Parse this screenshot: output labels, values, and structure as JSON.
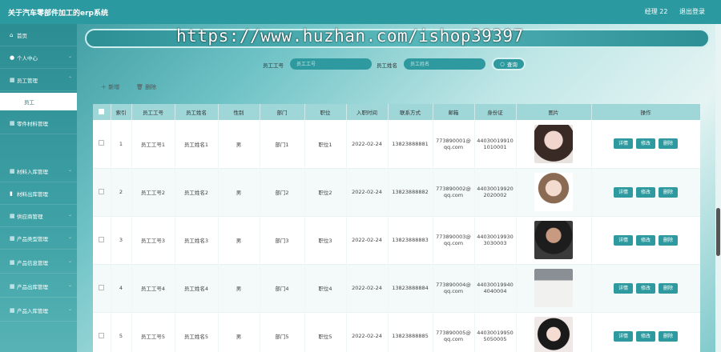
{
  "header": {
    "title": "关于汽车零部件加工的erp系统",
    "user": "经理 22",
    "logout": "退出登录"
  },
  "watermark_url": "https://www.huzhan.com/ishop39397",
  "sidebar": {
    "items": [
      {
        "label": "首页",
        "icon": "home-icon"
      },
      {
        "label": "个人中心",
        "icon": "user-icon"
      },
      {
        "label": "员工管理",
        "icon": "grid-icon"
      },
      {
        "label": "员工",
        "icon": ""
      },
      {
        "label": "零件材料管理",
        "icon": "grid-icon"
      },
      {
        "label": "材料入库管理",
        "icon": "grid-icon"
      },
      {
        "label": "材料出库管理",
        "icon": "chart-icon"
      },
      {
        "label": "供应商管理",
        "icon": "grid-icon"
      },
      {
        "label": "产品类型管理",
        "icon": "grid-icon"
      },
      {
        "label": "产品信息管理",
        "icon": "grid-icon"
      },
      {
        "label": "产品出库管理",
        "icon": "grid-icon"
      },
      {
        "label": "产品入库管理",
        "icon": "grid-icon"
      }
    ]
  },
  "search": {
    "emp_no_label": "员工工号",
    "emp_no_placeholder": "员工工号",
    "emp_name_label": "员工姓名",
    "emp_name_placeholder": "员工姓名",
    "button": "查询"
  },
  "actions": {
    "add": "新增",
    "delete": "删除"
  },
  "table": {
    "headers": [
      "索引",
      "员工工号",
      "员工姓名",
      "性别",
      "部门",
      "职位",
      "入职时间",
      "联系方式",
      "邮箱",
      "身份证",
      "图片",
      "操作"
    ],
    "rows": [
      {
        "idx": "1",
        "no": "员工工号1",
        "name": "员工姓名1",
        "gender": "男",
        "dept": "部门1",
        "pos": "职位1",
        "date": "2022-02-24",
        "phone": "13823888881",
        "email1": "773890001@",
        "email2": "qq.com",
        "id1": "44030019910",
        "id2": "1010001"
      },
      {
        "idx": "2",
        "no": "员工工号2",
        "name": "员工姓名2",
        "gender": "男",
        "dept": "部门2",
        "pos": "职位2",
        "date": "2022-02-24",
        "phone": "13823888882",
        "email1": "773890002@",
        "email2": "qq.com",
        "id1": "44030019920",
        "id2": "2020002"
      },
      {
        "idx": "3",
        "no": "员工工号3",
        "name": "员工姓名3",
        "gender": "男",
        "dept": "部门3",
        "pos": "职位3",
        "date": "2022-02-24",
        "phone": "13823888883",
        "email1": "773890003@",
        "email2": "qq.com",
        "id1": "44030019930",
        "id2": "3030003"
      },
      {
        "idx": "4",
        "no": "员工工号4",
        "name": "员工姓名4",
        "gender": "男",
        "dept": "部门4",
        "pos": "职位4",
        "date": "2022-02-24",
        "phone": "13823888884",
        "email1": "773890004@",
        "email2": "qq.com",
        "id1": "44030019940",
        "id2": "4040004"
      },
      {
        "idx": "5",
        "no": "员工工号5",
        "name": "员工姓名5",
        "gender": "男",
        "dept": "部门5",
        "pos": "职位5",
        "date": "2022-02-24",
        "phone": "13823888885",
        "email1": "773890005@",
        "email2": "qq.com",
        "id1": "44030019950",
        "id2": "5050005"
      }
    ],
    "ops": [
      "详情",
      "修改",
      "删除"
    ]
  },
  "colors": {
    "accent": "#2e9a9f",
    "header_row": "#9fd6d8"
  }
}
